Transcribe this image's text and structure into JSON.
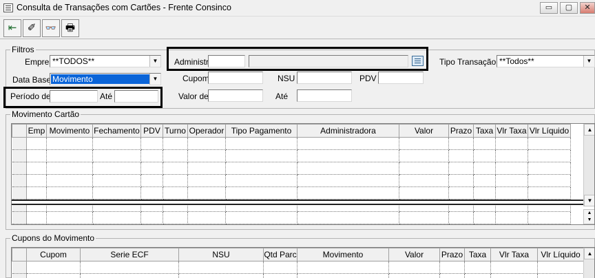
{
  "window": {
    "title": "Consulta de Transações com Cartões - Frente Consinco",
    "minimize_glyph": "▭",
    "maximize_glyph": "▢",
    "close_glyph": "✕"
  },
  "toolbar": {
    "buttons": [
      {
        "name": "exit-icon",
        "glyph": "⇤"
      },
      {
        "name": "clear-eraser-icon",
        "glyph": "✐"
      },
      {
        "name": "binoculars-search-icon",
        "glyph": "👓"
      },
      {
        "name": "printer-icon",
        "glyph": "🖶"
      }
    ]
  },
  "filters": {
    "group_label": "Filtros",
    "empresa_label": "Empresa",
    "empresa_value": "**TODOS**",
    "data_base_label": "Data Base",
    "data_base_value": "Movimento",
    "periodo_label": "Período de",
    "periodo_from": "",
    "ate_label": "Até",
    "periodo_to": "",
    "administr_label": "Administr.",
    "administr_code": "",
    "administr_name": "",
    "cupom_label": "Cupom",
    "cupom_value": "",
    "nsu_label": "NSU",
    "nsu_value": "",
    "pdv_label": "PDV",
    "pdv_value": "",
    "valor_de_label": "Valor de",
    "valor_de_value": "",
    "valor_ate_label": "Até",
    "valor_ate_value": "",
    "tipo_transacao_label": "Tipo Transação",
    "tipo_transacao_value": "**Todos**"
  },
  "movimento": {
    "group_label": "Movimento Cartão",
    "columns": [
      "Emp",
      "Movimento",
      "Fechamento",
      "PDV",
      "Turno",
      "Operador",
      "Tipo Pagamento",
      "Administradora",
      "Valor",
      "Prazo",
      "Taxa",
      "Vlr Taxa",
      "Vlr Líquido"
    ]
  },
  "cupons": {
    "group_label": "Cupons do Movimento",
    "columns": [
      "Cupom",
      "Serie ECF",
      "NSU",
      "Qtd Parc",
      "Movimento",
      "Valor",
      "Prazo",
      "Taxa",
      "Vlr Taxa",
      "Vlr Líquido"
    ]
  },
  "colors": {
    "selected_bg": "#0a64d8",
    "selected_fg": "#ffffff",
    "window_bg": "#f0f0f0"
  }
}
